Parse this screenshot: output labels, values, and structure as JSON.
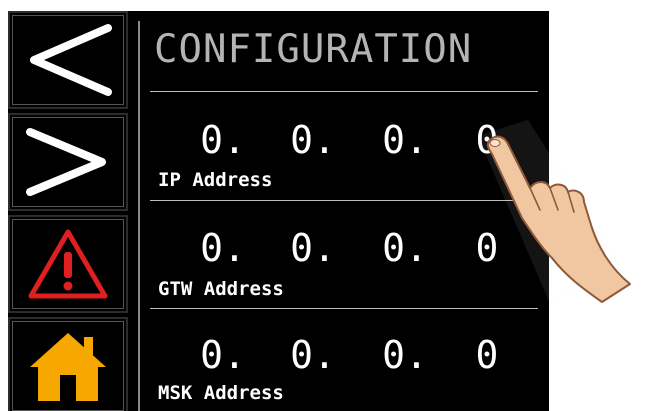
{
  "title": "CONFIGURATION",
  "nav": {
    "back_icon": "chevron-left-icon",
    "forward_icon": "chevron-right-icon",
    "alarm_icon": "warning-triangle-icon",
    "home_icon": "home-icon"
  },
  "fields": [
    {
      "label": "IP Address",
      "octets": [
        "0.",
        "0.",
        "0.",
        "0"
      ]
    },
    {
      "label": "GTW Address",
      "octets": [
        "0.",
        "0.",
        "0.",
        "0"
      ]
    },
    {
      "label": "MSK Address",
      "octets": [
        "0.",
        "0.",
        "0.",
        "0"
      ]
    }
  ],
  "colors": {
    "background": "#000000",
    "title": "#b4b4b4",
    "warning_red": "#e02020",
    "home_orange": "#f6a700"
  }
}
